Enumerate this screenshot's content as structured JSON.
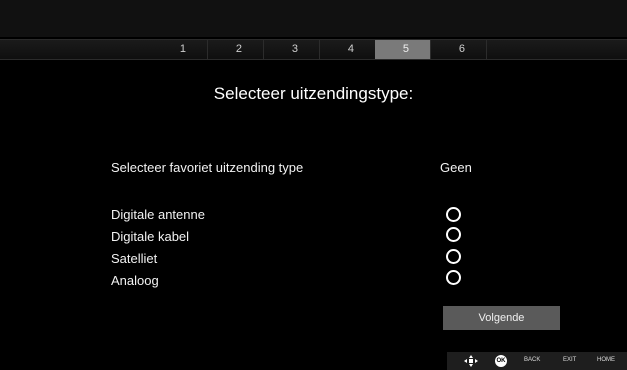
{
  "steps": [
    "1",
    "2",
    "3",
    "4",
    "5",
    "6"
  ],
  "active_step": "5",
  "title": "Selecteer uitzendingstype:",
  "favorite": {
    "label": "Selecteer favoriet uitzending type",
    "value": "Geen"
  },
  "options": [
    "Digitale antenne",
    "Digitale kabel",
    "Satelliet",
    "Analoog"
  ],
  "next_button": "Volgende",
  "legend": {
    "ok": "OK",
    "back": "BACK",
    "exit": "EXIT",
    "home": "HOME",
    "nav_icon": "dpad-icon"
  }
}
